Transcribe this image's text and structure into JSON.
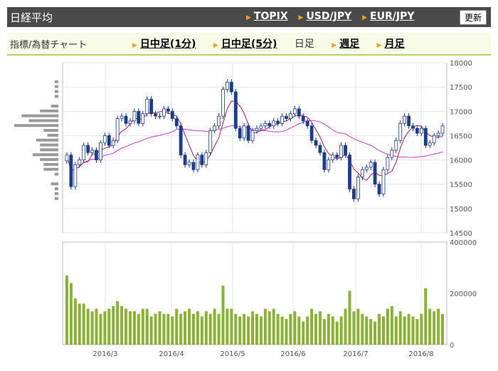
{
  "header": {
    "title": "日経平均",
    "links": [
      "TOPIX",
      "USD/JPY",
      "EUR/JPY"
    ],
    "refresh_label": "更新"
  },
  "subbar": {
    "label": "指標/為替チャート",
    "tabs": [
      {
        "label": "日中足(1分)",
        "link": true
      },
      {
        "label": "日中足(5分)",
        "link": true
      },
      {
        "label": "日足",
        "link": false
      },
      {
        "label": "週足",
        "link": true
      },
      {
        "label": "月足",
        "link": true
      }
    ]
  },
  "colors": {
    "accent": "#f0a020",
    "volume": "#8ab234",
    "candle": "#1a3d8f",
    "ma_short": "#c0105a",
    "ma_long": "#c43ed0"
  },
  "chart_data": [
    {
      "type": "candlestick",
      "y_ticks": [
        "18000",
        "17500",
        "17000",
        "16500",
        "16000",
        "15500",
        "15000",
        "14500"
      ],
      "ylim": [
        14500,
        18000
      ],
      "x_ticks": [
        "2016/3",
        "2016/4",
        "2016/5",
        "2016/6",
        "2016/7",
        "2016/8"
      ],
      "close": [
        16100,
        15450,
        15900,
        16000,
        16300,
        16150,
        16200,
        16000,
        16350,
        16500,
        16300,
        16400,
        16850,
        16900,
        16750,
        16800,
        17000,
        16750,
        16950,
        17250,
        16950,
        16900,
        16900,
        17050,
        17000,
        16850,
        16700,
        16100,
        15900,
        15950,
        15800,
        16100,
        15900,
        16150,
        16600,
        16700,
        16900,
        17450,
        17600,
        17400,
        16650,
        16450,
        16700,
        16400,
        16600,
        16650,
        16700,
        16750,
        16700,
        16800,
        16750,
        16900,
        16850,
        16950,
        17050,
        16900,
        16800,
        16700,
        16400,
        16300,
        16150,
        15800,
        16000,
        16100,
        16050,
        16300,
        16100,
        15400,
        15200,
        15650,
        15800,
        15850,
        15950,
        15500,
        15300,
        15800,
        16050,
        16200,
        16400,
        16750,
        16900,
        16700,
        16650,
        16550,
        16650,
        16300,
        16350,
        16500,
        16550,
        16700
      ],
      "volume": [
        270000,
        240000,
        180000,
        160000,
        160000,
        140000,
        130000,
        140000,
        120000,
        130000,
        140000,
        150000,
        170000,
        150000,
        140000,
        130000,
        130000,
        120000,
        140000,
        140000,
        110000,
        120000,
        130000,
        120000,
        120000,
        110000,
        140000,
        120000,
        130000,
        140000,
        120000,
        130000,
        110000,
        130000,
        120000,
        140000,
        120000,
        230000,
        140000,
        140000,
        120000,
        110000,
        120000,
        110000,
        130000,
        120000,
        110000,
        140000,
        130000,
        140000,
        120000,
        110000,
        100000,
        120000,
        130000,
        110000,
        90000,
        110000,
        140000,
        120000,
        130000,
        100000,
        120000,
        110000,
        90000,
        110000,
        140000,
        210000,
        130000,
        140000,
        120000,
        110000,
        100000,
        90000,
        120000,
        110000,
        140000,
        150000,
        110000,
        130000,
        110000,
        120000,
        110000,
        100000,
        120000,
        220000,
        140000,
        130000,
        140000,
        120000
      ],
      "volume_ticks": [
        "400000",
        "200000",
        "0"
      ],
      "volume_max": 400000
    }
  ]
}
